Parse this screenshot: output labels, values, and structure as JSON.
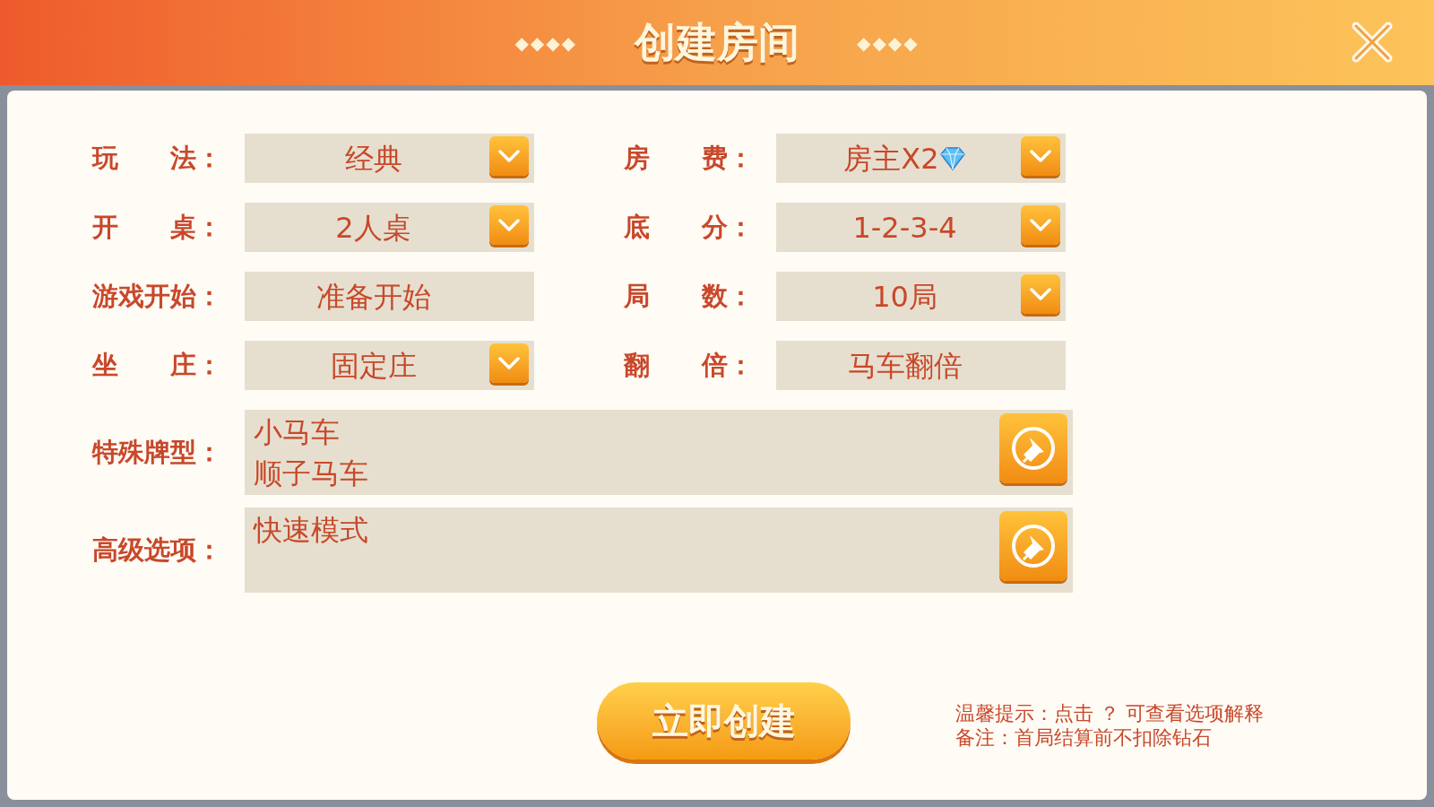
{
  "window": {
    "title": "创建房间"
  },
  "title_decor_left": "◆◆◆◆",
  "title_decor_right": "◆◆◆◆",
  "rows": [
    {
      "left": {
        "label": "玩　　法：",
        "value": "经典",
        "kind": "dropdown"
      },
      "right": {
        "label": "房　　费：",
        "value": "房主X2",
        "kind": "dropdown",
        "diamond": true
      }
    },
    {
      "left": {
        "label": "开　　桌：",
        "value": "2人桌",
        "kind": "dropdown"
      },
      "right": {
        "label": "底　　分：",
        "value": "1-2-3-4",
        "kind": "dropdown"
      }
    },
    {
      "left": {
        "label": "游戏开始：",
        "value": "准备开始",
        "kind": "static"
      },
      "right": {
        "label": "局　　数：",
        "value": "10局",
        "kind": "dropdown"
      }
    },
    {
      "left": {
        "label": "坐　　庄：",
        "value": "固定庄",
        "kind": "dropdown"
      },
      "right": {
        "label": "翻　　倍：",
        "value": "马车翻倍",
        "kind": "static"
      }
    }
  ],
  "options": [
    {
      "label": "特殊牌型：",
      "items": [
        "小马车",
        "顺子马车"
      ]
    },
    {
      "label": "高级选项：",
      "items": [
        "快速模式"
      ]
    }
  ],
  "create_button": "立即创建",
  "notes": [
    "温馨提示：点击 ？ 可查看选项解释",
    "备注：首局结算前不扣除钻石"
  ]
}
